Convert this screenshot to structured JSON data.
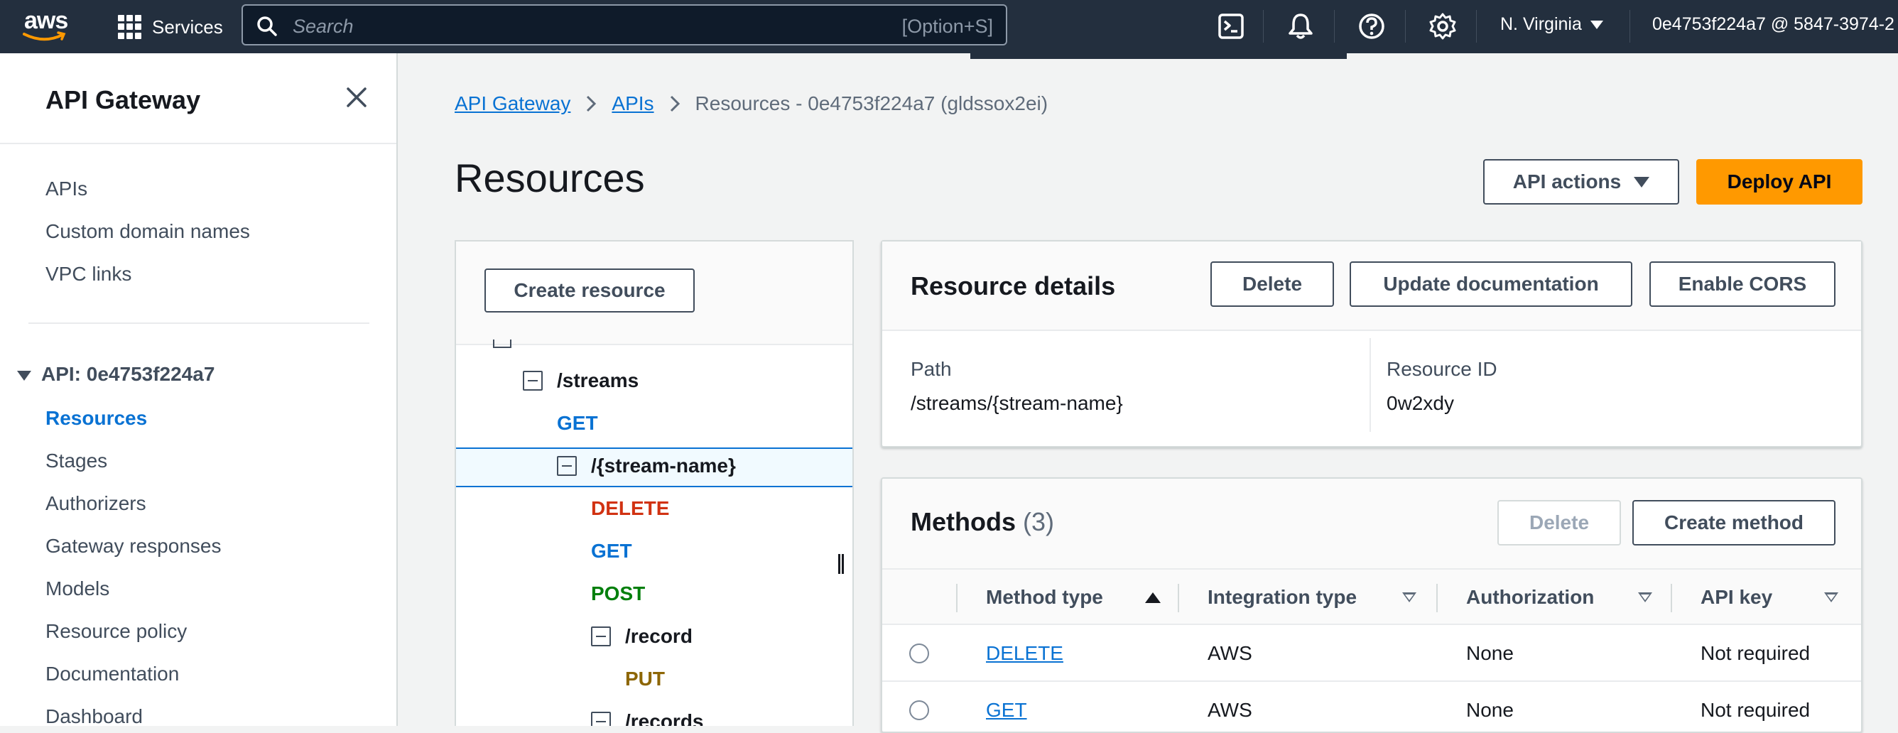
{
  "topnav": {
    "logo_text": "aws",
    "services_label": "Services",
    "search_placeholder": "Search",
    "search_shortcut": "[Option+S]",
    "region": "N. Virginia",
    "account": "0e4753f224a7 @ 5847-3974-2"
  },
  "sidebar": {
    "title": "API Gateway",
    "top_items": [
      "APIs",
      "Custom domain names",
      "VPC links"
    ],
    "api_section": "API: 0e4753f224a7",
    "api_items": [
      "Resources",
      "Stages",
      "Authorizers",
      "Gateway responses",
      "Models",
      "Resource policy",
      "Documentation",
      "Dashboard"
    ],
    "active_item": "Resources"
  },
  "breadcrumb": {
    "items": [
      "API Gateway",
      "APIs"
    ],
    "current": "Resources - 0e4753f224a7 (gldssox2ei)"
  },
  "page": {
    "title": "Resources",
    "api_actions_label": "API actions",
    "deploy_label": "Deploy API"
  },
  "tree": {
    "create_resource_label": "Create resource",
    "nodes": [
      {
        "label": "/streams",
        "kind": "resource"
      },
      {
        "label": "GET",
        "kind": "method"
      },
      {
        "label": "/{stream-name}",
        "kind": "resource",
        "selected": true
      },
      {
        "label": "DELETE",
        "kind": "method"
      },
      {
        "label": "GET",
        "kind": "method"
      },
      {
        "label": "POST",
        "kind": "method"
      },
      {
        "label": "/record",
        "kind": "resource"
      },
      {
        "label": "PUT",
        "kind": "method"
      },
      {
        "label": "/records",
        "kind": "resource"
      }
    ]
  },
  "resource_details": {
    "title": "Resource details",
    "delete_label": "Delete",
    "update_doc_label": "Update documentation",
    "cors_label": "Enable CORS",
    "path_label": "Path",
    "path_value": "/streams/{stream-name}",
    "id_label": "Resource ID",
    "id_value": "0w2xdy"
  },
  "methods": {
    "title": "Methods",
    "count": "(3)",
    "delete_label": "Delete",
    "create_label": "Create method",
    "columns": [
      "Method type",
      "Integration type",
      "Authorization",
      "API key"
    ],
    "rows": [
      {
        "method": "DELETE",
        "integration": "AWS",
        "authorization": "None",
        "api_key": "Not required"
      },
      {
        "method": "GET",
        "integration": "AWS",
        "authorization": "None",
        "api_key": "Not required"
      }
    ]
  },
  "colors": {
    "nav_bg": "#232f3e",
    "link": "#0972d3",
    "primary": "#ff9900",
    "method_delete": "#d13212",
    "method_post": "#037f0c",
    "method_put": "#8d6605"
  },
  "icons": [
    "grid-icon",
    "search-icon",
    "cloudshell-icon",
    "bell-icon",
    "help-icon",
    "gear-icon",
    "close-icon",
    "minus-square-icon",
    "sort-icon",
    "caret-down-icon"
  ]
}
